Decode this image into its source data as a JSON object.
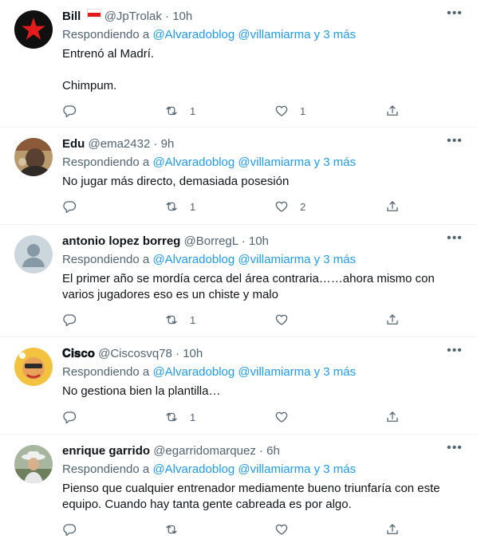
{
  "tweets": [
    {
      "name": "Bill",
      "flag": "🇮🇩",
      "handle": "@JpTrolak",
      "dot": "·",
      "time": "10h",
      "reply_prefix": "Respondiendo a ",
      "reply_users": "@Alvaradoblog @villamiarma y 3 más",
      "text": "Entrenó al Madrí.\n\nChimpum.",
      "retweets": "1",
      "likes": "1",
      "avatar_colors": {
        "bg": "#101010",
        "fg": "#e21b1b"
      }
    },
    {
      "name": "Edu",
      "handle": "@ema2432",
      "dot": "·",
      "time": "9h",
      "reply_prefix": "Respondiendo a ",
      "reply_users": "@Alvaradoblog @villamiarma y 3 más",
      "text": "No jugar más directo, demasiada posesión",
      "retweets": "1",
      "likes": "2",
      "avatar_colors": {
        "bg": "#c7b18a",
        "fg": "#3a2a20"
      }
    },
    {
      "name": "antonio lopez borreg",
      "handle": "@BorregL",
      "dot": "·",
      "time": "10h",
      "reply_prefix": "Respondiendo a ",
      "reply_users": "@Alvaradoblog @villamiarma y 3 más",
      "text": "El primer año se mordía cerca del área contraria……ahora mismo con varios jugadores eso es un chiste y malo",
      "retweets": "1",
      "likes": "",
      "avatar_colors": {
        "bg": "#ccd6dd",
        "fg": "#8899a6"
      }
    },
    {
      "name": "𝐂𝐢𝐬𝐜𝐨",
      "handle": "@Ciscosvq78",
      "dot": "·",
      "time": "10h",
      "reply_prefix": "Respondiendo a ",
      "reply_users": "@Alvaradoblog @villamiarma y 3 más",
      "text": "No gestiona bien la plantilla…",
      "retweets": "1",
      "likes": "",
      "avatar_colors": {
        "bg": "#f3c340",
        "fg": "#c0392b"
      }
    },
    {
      "name": "enrique garrido",
      "handle": "@egarridomarquez",
      "dot": "·",
      "time": "6h",
      "reply_prefix": "Respondiendo a ",
      "reply_users": "@Alvaradoblog @villamiarma y 3 más",
      "text": "Pienso que cualquier entrenador mediamente bueno triunfaría con este equipo. Cuando hay tanta gente cabreada es por algo.",
      "retweets": "",
      "likes": "",
      "avatar_colors": {
        "bg": "#a8b6a0",
        "fg": "#f0f0f0"
      }
    }
  ],
  "icons": {
    "reply": "reply-icon",
    "retweet": "retweet-icon",
    "like": "heart-icon",
    "share": "share-icon",
    "more": "more-options-icon"
  },
  "ui_colors": {
    "link": "#1d9bf0",
    "secondary": "#536471",
    "text": "#0f1419",
    "divider": "#eff3f4"
  }
}
